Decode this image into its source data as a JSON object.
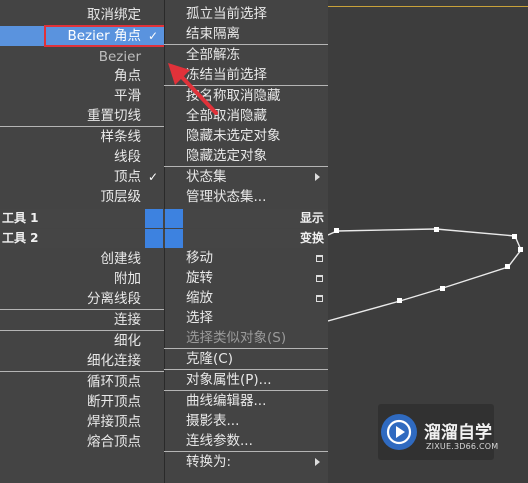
{
  "left_menu": {
    "items": [
      {
        "label": "取消绑定",
        "checked": false,
        "highlighted": false
      },
      {
        "label": "Bezier 角点",
        "checked": true,
        "highlighted": true
      },
      {
        "label": "Bezier",
        "checked": false,
        "highlighted": false,
        "dim": true
      },
      {
        "label": "角点",
        "checked": false,
        "highlighted": false
      },
      {
        "label": "平滑",
        "checked": false,
        "highlighted": false
      },
      {
        "label": "重置切线",
        "checked": false,
        "highlighted": false
      },
      {
        "label": "样条线",
        "checked": false,
        "highlighted": false
      },
      {
        "label": "线段",
        "checked": false,
        "highlighted": false
      },
      {
        "label": "顶点",
        "checked": true,
        "highlighted": false
      },
      {
        "label": "顶层级",
        "checked": false,
        "highlighted": false
      }
    ],
    "check_glyph": "✓",
    "lower_items": [
      {
        "label": "创建线"
      },
      {
        "label": "附加"
      },
      {
        "label": "分离线段"
      },
      {
        "label": "连接"
      },
      {
        "label": "细化"
      },
      {
        "label": "细化连接"
      },
      {
        "label": "循环顶点"
      },
      {
        "label": "断开顶点"
      },
      {
        "label": "焊接顶点"
      },
      {
        "label": "熔合顶点"
      }
    ]
  },
  "bands": [
    {
      "left": "工具 1",
      "right": "显示"
    },
    {
      "left": "工具 2",
      "right": "变换"
    }
  ],
  "right_menu": {
    "items": [
      {
        "label": "孤立当前选择"
      },
      {
        "label": "结束隔离"
      },
      {
        "label": "全部解冻"
      },
      {
        "label": "冻结当前选择"
      },
      {
        "label": "按名称取消隐藏"
      },
      {
        "label": "全部取消隐藏"
      },
      {
        "label": "隐藏未选定对象"
      },
      {
        "label": "隐藏选定对象"
      },
      {
        "label": "状态集"
      },
      {
        "label": "管理状态集..."
      }
    ],
    "lower_items": [
      {
        "label": "移动"
      },
      {
        "label": "旋转"
      },
      {
        "label": "缩放"
      },
      {
        "label": "选择"
      },
      {
        "label": "选择类似对象(S)",
        "disabled": true
      },
      {
        "label": "克隆(C)"
      },
      {
        "label": "对象属性(P)..."
      },
      {
        "label": "曲线编辑器..."
      },
      {
        "label": "摄影表..."
      },
      {
        "label": "连线参数..."
      },
      {
        "label": "转换为:"
      }
    ]
  },
  "watermark": {
    "title": "溜溜自学",
    "subtitle": "ZIXUE.3D66.COM",
    "icon": "play-icon"
  },
  "colors": {
    "highlight": "#5a93de",
    "band_square": "#3d82e0",
    "annotation_red": "#e0323a",
    "viewport_line": "#c8a13a"
  }
}
